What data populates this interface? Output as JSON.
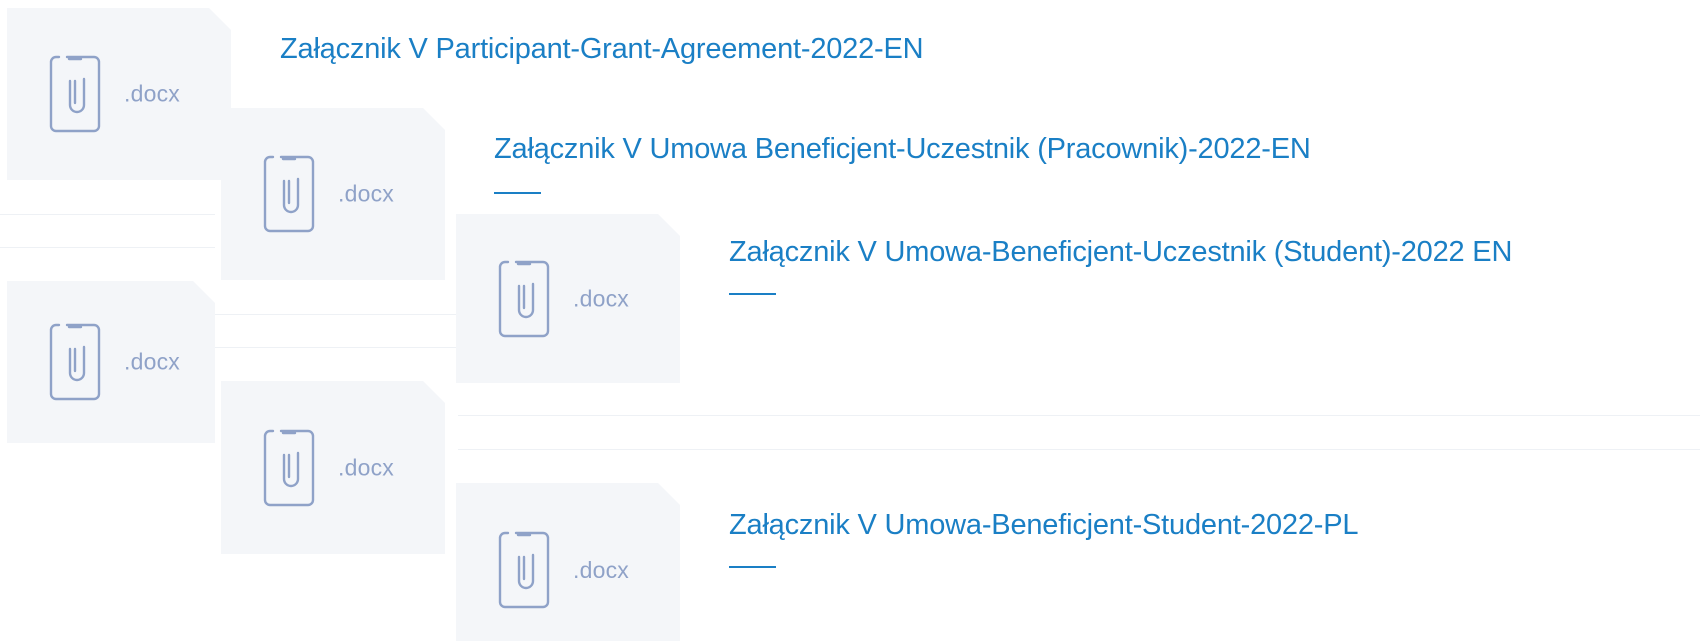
{
  "files": [
    {
      "title": "Załącznik V Participant-Grant-Agreement-2022-EN",
      "ext": ".docx",
      "icon": "document-paperclip-icon"
    },
    {
      "title": "Załącznik V Umowa Beneficjent-Uczestnik (Pracownik)-2022-EN",
      "ext": ".docx",
      "icon": "document-paperclip-icon"
    },
    {
      "title": "Załącznik V Umowa-Beneficjent-Uczestnik (Student)-2022 EN",
      "ext": ".docx",
      "icon": "document-paperclip-icon"
    },
    {
      "title": "",
      "ext": ".docx",
      "icon": "document-paperclip-icon"
    },
    {
      "title": "",
      "ext": ".docx",
      "icon": "document-paperclip-icon"
    },
    {
      "title": "Załącznik V Umowa-Beneficjent-Student-2022-PL",
      "ext": ".docx",
      "icon": "document-paperclip-icon"
    }
  ],
  "colors": {
    "link": "#1a7fc5",
    "icon_bg": "#f4f6f9",
    "icon_stroke": "#8fa2c8",
    "divider": "#eef1f5"
  }
}
